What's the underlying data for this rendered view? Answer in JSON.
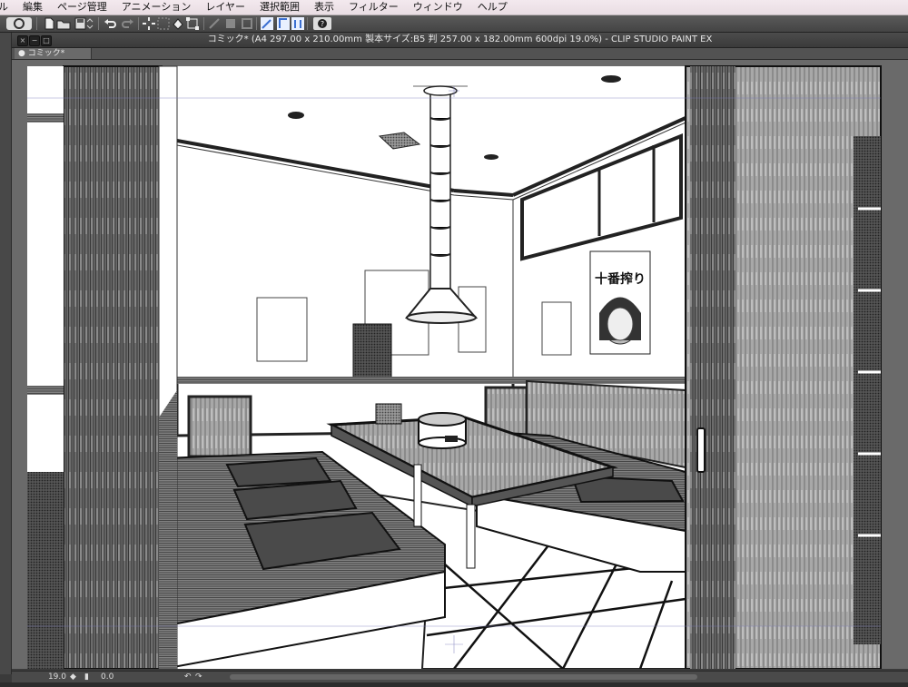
{
  "menubar": {
    "items": [
      "ル",
      "編集",
      "ページ管理",
      "アニメーション",
      "レイヤー",
      "選択範囲",
      "表示",
      "フィルター",
      "ウィンドウ",
      "ヘルプ"
    ]
  },
  "toolbar": {
    "icons": [
      "app-logo-icon",
      "new-file-icon",
      "open-file-icon",
      "save-icon",
      "undo-icon",
      "redo-icon",
      "transform-icon",
      "select-icon",
      "fill-icon",
      "pen-icon",
      "ruler-icon",
      "snap-icon",
      "help-icon"
    ]
  },
  "window": {
    "title": "コミック* (A4 297.00 x 210.00mm 製本サイズ:B5 判 257.00 x 182.00mm 600dpi 19.0%)  - CLIP STUDIO PAINT EX",
    "tab_label": "● コミック*"
  },
  "canvas": {
    "poster_text": "十番搾り",
    "background_color": "#ffffff",
    "workspace_color": "#6a6a6a"
  },
  "statusbar": {
    "zoom": "19.0",
    "angle": "0.0"
  },
  "colors": {
    "menubar_bg": "#efe5ea",
    "toolbar_bg": "#4c4c4c",
    "accent": "#3b6fd1"
  }
}
